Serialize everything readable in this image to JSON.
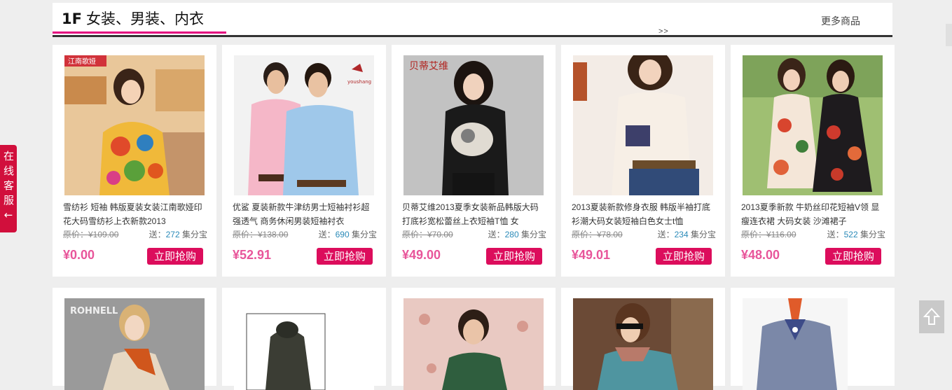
{
  "floor": {
    "number": "1F",
    "title": "女装、男装、内衣",
    "more_label": "更多商品",
    "more_arrow": ">>"
  },
  "side_service": {
    "label": "在线客服",
    "arrow": "←"
  },
  "products": [
    {
      "title": "雪纺衫 短袖 韩版夏装女装江南歌娅印花大码雪纺衫上衣新款2013",
      "orig_price": "原价：¥109.00",
      "points_prefix": "送：",
      "points": "272",
      "points_suffix": "集分宝",
      "price": "¥0.00",
      "buy_label": "立即抢购"
    },
    {
      "title": "优鲨 夏装新款牛津纺男士短袖衬衫超强透气 商务休闲男装短袖衬衣",
      "orig_price": "原价：¥138.00",
      "points_prefix": "送：",
      "points": "690",
      "points_suffix": "集分宝",
      "price": "¥52.91",
      "buy_label": "立即抢购"
    },
    {
      "title": "贝蒂艾维2013夏季女装新品韩版大码打底衫宽松蕾丝上衣短袖T恤 女",
      "orig_price": "原价：¥70.00",
      "points_prefix": "送：",
      "points": "280",
      "points_suffix": "集分宝",
      "price": "¥49.00",
      "buy_label": "立即抢购"
    },
    {
      "title": "2013夏装新款修身衣服 韩版半袖打底衫潮大码女装短袖白色女士t恤",
      "orig_price": "原价：¥78.00",
      "points_prefix": "送：",
      "points": "234",
      "points_suffix": "集分宝",
      "price": "¥49.01",
      "buy_label": "立即抢购"
    },
    {
      "title": "2013夏季新款 牛奶丝印花短袖V领 显瘦连衣裙 大码女装 沙滩裙子",
      "orig_price": "原价：¥116.00",
      "points_prefix": "送：",
      "points": "522",
      "points_suffix": "集分宝",
      "price": "¥48.00",
      "buy_label": "立即抢购"
    }
  ],
  "row2_brand": "ROHNELL",
  "colors": {
    "accent": "#e4007f",
    "buy": "#dc0d5c",
    "price": "#e8559a",
    "points": "#2a8ab8"
  }
}
